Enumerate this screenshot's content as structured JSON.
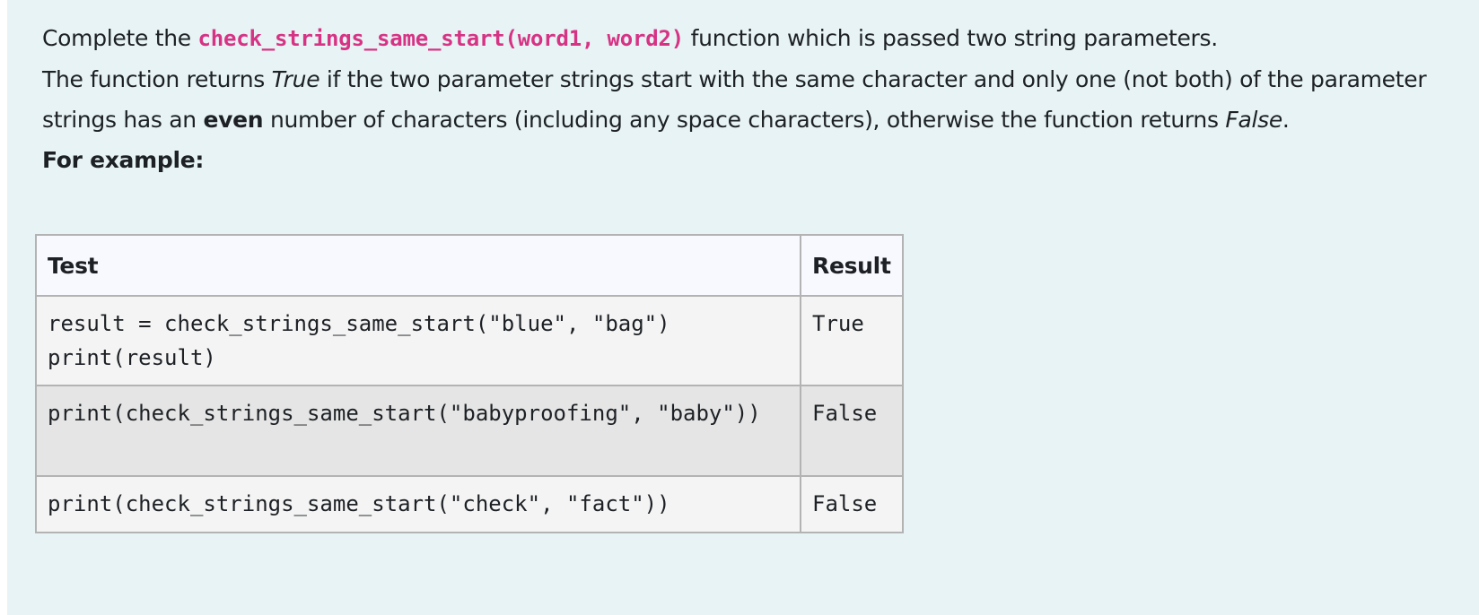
{
  "question": {
    "intro_before": "Complete the ",
    "function_signature": "check_strings_same_start(word1, word2)",
    "intro_after": " function which is passed two string parameters.",
    "line2_before": "The function returns ",
    "true_word": "True",
    "line2_after": " if the two parameter strings start with the same character and only one (not both) of the parameter strings has an ",
    "even_word": "even",
    "line3_after": " number of characters (including any space characters), otherwise the function returns ",
    "false_word": "False",
    "period": ".",
    "example_heading": "For example:"
  },
  "table": {
    "headers": {
      "test": "Test",
      "result": "Result"
    },
    "rows": [
      {
        "test": "result = check_strings_same_start(\"blue\", \"bag\")\nprint(result)",
        "result": "True"
      },
      {
        "test": "print(check_strings_same_start(\"babyproofing\", \"baby\"))",
        "result": "False"
      },
      {
        "test": "print(check_strings_same_start(\"check\", \"fact\"))",
        "result": "False"
      }
    ]
  },
  "colors": {
    "panel_background": "#e7f3f5",
    "code_accent": "#d63384",
    "text": "#1d2125"
  }
}
